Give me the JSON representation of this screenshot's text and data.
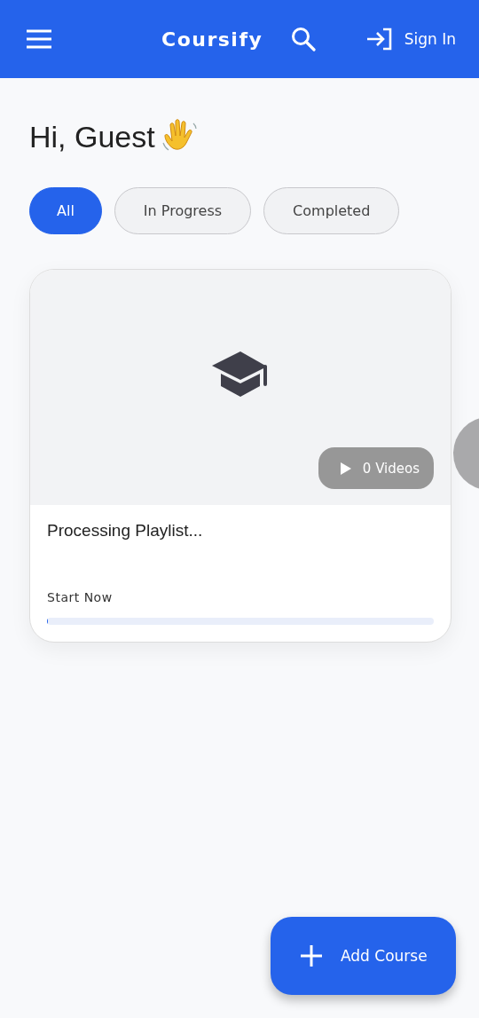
{
  "header": {
    "title": "Coursify",
    "sign_in": "Sign In"
  },
  "greeting": "Hi, Guest",
  "filters": [
    {
      "label": "All",
      "selected": true
    },
    {
      "label": "In Progress",
      "selected": false
    },
    {
      "label": "Completed",
      "selected": false
    }
  ],
  "courses": [
    {
      "title": "Processing Playlist...",
      "videos": "0 Videos",
      "action": "Start Now",
      "level": 0
    }
  ],
  "fab": {
    "label": "Add Course"
  }
}
